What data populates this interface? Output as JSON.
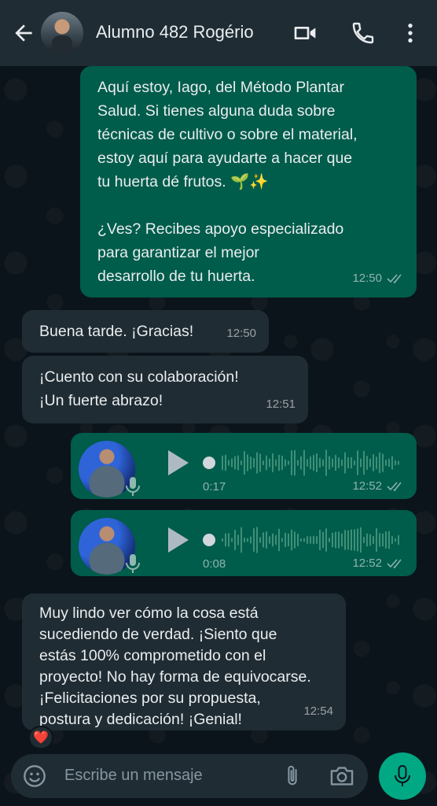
{
  "header": {
    "contact_name": "Alumno 482 Rogério",
    "icons": [
      "back-arrow-icon",
      "video-call-icon",
      "phone-icon",
      "more-vert-icon"
    ]
  },
  "messages": {
    "m1": {
      "text": "Aquí estoy, Iago, del Método Plantar\nSalud. Si tienes alguna duda sobre\ntécnicas de cultivo o sobre el material,\nestoy aquí para ayudarte a hacer que\ntu huerta dé frutos. 🌱✨\n\n¿Ves? Recibes apoyo especializado\npara garantizar el mejor\ndesarrollo de tu huerta.",
      "time": "12:50"
    },
    "m2": {
      "text": "Buena tarde. ¡Gracias!",
      "time": "12:50"
    },
    "m3": {
      "text": "¡Cuento con su colaboración!\n¡Un fuerte abrazo!",
      "time": "12:51"
    },
    "v1": {
      "duration": "0:17",
      "time": "12:52"
    },
    "v2": {
      "duration": "0:08",
      "time": "12:52"
    },
    "m4": {
      "text": "Muy lindo ver cómo la cosa está\nsucediendo de verdad. ¡Siento que\nestás 100% comprometido con el\nproyecto! No hay forma de equivocarse.\n¡Felicitaciones por su propuesta,\npostura y dedicación! ¡Genial!",
      "time": "12:54",
      "reaction": "❤️"
    }
  },
  "input": {
    "placeholder": "Escribe un mensaje"
  },
  "colors": {
    "outgoing_bubble": "#005c4b",
    "incoming_bubble": "#202c33",
    "header": "#1f2c34",
    "accent": "#00a884",
    "background": "#0b141a"
  }
}
